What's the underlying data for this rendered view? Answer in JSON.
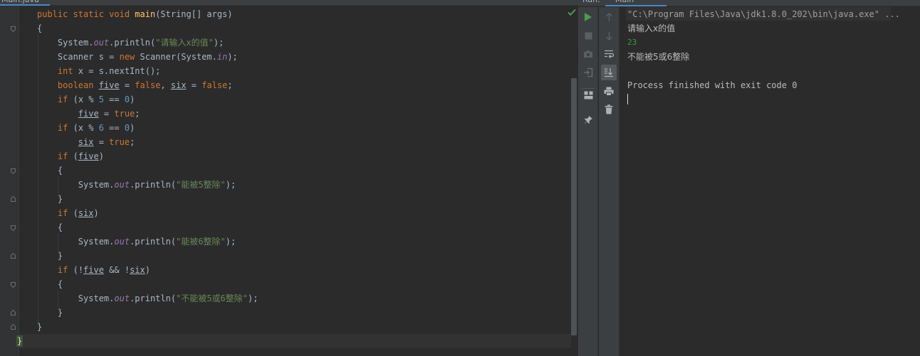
{
  "editor": {
    "tab_label": "Main.java",
    "lines": [
      [
        [
          "kw",
          "public static void "
        ],
        [
          "fn",
          "main"
        ],
        [
          "",
          "(String[] args)"
        ]
      ],
      [
        [
          "",
          "{"
        ]
      ],
      [
        [
          "",
          "    System."
        ],
        [
          "fld",
          "out"
        ],
        [
          "",
          ".println("
        ],
        [
          "str",
          "\"请输入x的值\""
        ],
        [
          "",
          ");"
        ]
      ],
      [
        [
          "",
          "    Scanner s = "
        ],
        [
          "kw",
          "new "
        ],
        [
          "",
          "Scanner(System."
        ],
        [
          "fld",
          "in"
        ],
        [
          "",
          ");"
        ]
      ],
      [
        [
          "",
          "    "
        ],
        [
          "kw",
          "int "
        ],
        [
          "",
          "x = s.nextInt();"
        ]
      ],
      [
        [
          "",
          "    "
        ],
        [
          "kw",
          "boolean "
        ],
        [
          "var",
          "five"
        ],
        [
          "",
          " = "
        ],
        [
          "kw",
          "false"
        ],
        [
          "",
          ", "
        ],
        [
          "var",
          "six"
        ],
        [
          "",
          " = "
        ],
        [
          "kw",
          "false"
        ],
        [
          "",
          ";"
        ]
      ],
      [
        [
          "",
          "    "
        ],
        [
          "kw",
          "if "
        ],
        [
          "",
          "(x % "
        ],
        [
          "num",
          "5"
        ],
        [
          "",
          " == "
        ],
        [
          "num",
          "0"
        ],
        [
          "",
          ")"
        ]
      ],
      [
        [
          "",
          "        "
        ],
        [
          "var",
          "five"
        ],
        [
          "",
          " = "
        ],
        [
          "kw",
          "true"
        ],
        [
          "",
          ";"
        ]
      ],
      [
        [
          "",
          "    "
        ],
        [
          "kw",
          "if "
        ],
        [
          "",
          "(x % "
        ],
        [
          "num",
          "6"
        ],
        [
          "",
          " == "
        ],
        [
          "num",
          "0"
        ],
        [
          "",
          ")"
        ]
      ],
      [
        [
          "",
          "        "
        ],
        [
          "var",
          "six"
        ],
        [
          "",
          " = "
        ],
        [
          "kw",
          "true"
        ],
        [
          "",
          ";"
        ]
      ],
      [
        [
          "",
          "    "
        ],
        [
          "kw",
          "if "
        ],
        [
          "",
          "("
        ],
        [
          "var",
          "five"
        ],
        [
          "",
          ")"
        ]
      ],
      [
        [
          "",
          "    {"
        ]
      ],
      [
        [
          "",
          "        System."
        ],
        [
          "fld",
          "out"
        ],
        [
          "",
          ".println("
        ],
        [
          "str",
          "\"能被5整除\""
        ],
        [
          "",
          ");"
        ]
      ],
      [
        [
          "",
          "    }"
        ]
      ],
      [
        [
          "",
          "    "
        ],
        [
          "kw",
          "if "
        ],
        [
          "",
          "("
        ],
        [
          "var",
          "six"
        ],
        [
          "",
          ")"
        ]
      ],
      [
        [
          "",
          "    {"
        ]
      ],
      [
        [
          "",
          "        System."
        ],
        [
          "fld",
          "out"
        ],
        [
          "",
          ".println("
        ],
        [
          "str",
          "\"能被6整除\""
        ],
        [
          "",
          ");"
        ]
      ],
      [
        [
          "",
          "    }"
        ]
      ],
      [
        [
          "",
          "    "
        ],
        [
          "kw",
          "if "
        ],
        [
          "",
          "(!"
        ],
        [
          "var",
          "five"
        ],
        [
          "",
          " && !"
        ],
        [
          "var",
          "six"
        ],
        [
          "",
          ")"
        ]
      ],
      [
        [
          "",
          "    {"
        ]
      ],
      [
        [
          "",
          "        System."
        ],
        [
          "fld",
          "out"
        ],
        [
          "",
          ".println("
        ],
        [
          "str",
          "\"不能被5或6整除\""
        ],
        [
          "",
          ");"
        ]
      ],
      [
        [
          "",
          "    }"
        ]
      ],
      [
        [
          "",
          "}"
        ]
      ],
      [
        [
          "brace",
          "}"
        ]
      ]
    ]
  },
  "run": {
    "tab_a": "Run:",
    "tab_b": "Main",
    "console": {
      "command": "\"C:\\Program Files\\Java\\jdk1.8.0_202\\bin\\java.exe\" ...",
      "prompt": "请输入x的值",
      "input": "23",
      "output": "不能被5或6整除",
      "blank": "",
      "exit": "Process finished with exit code 0"
    }
  },
  "icons": {
    "rerun": "play-icon",
    "stop": "stop-icon",
    "camera": "camera-icon",
    "login": "exit-icon",
    "layout": "layout-icon",
    "pin": "pin-icon",
    "up": "arrow-up-icon",
    "down": "arrow-down-icon",
    "softwrap": "soft-wrap-icon",
    "scrollend": "scroll-to-end-icon",
    "print": "print-icon",
    "trash": "trash-icon",
    "check": "check-icon"
  },
  "colors": {
    "keyword": "#cc7832",
    "function": "#ffc66d",
    "string": "#6a8759",
    "number": "#6897bb",
    "field": "#9876aa",
    "input": "#3c9a3c",
    "run_green": "#499c54"
  }
}
